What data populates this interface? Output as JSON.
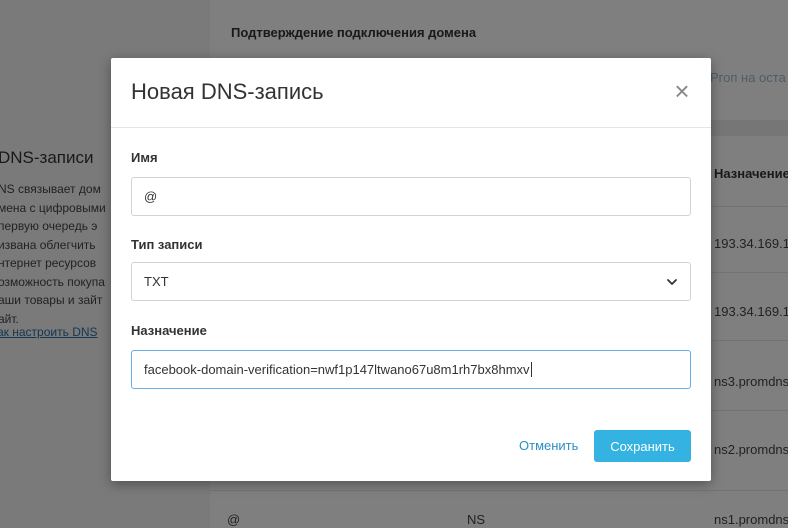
{
  "background": {
    "section_heading": "Подтверждение подключения домена",
    "faint_link": "Ргоп на оста",
    "table": {
      "column_header": "Назначение",
      "rows": [
        {
          "value": "193.34.169.1"
        },
        {
          "value": "193.34.169.1"
        },
        {
          "value": "ns3.promdns"
        },
        {
          "value": "ns2.promdns"
        },
        {
          "name": "@",
          "type": "NS",
          "value": "ns1.promdns"
        }
      ]
    },
    "sidebar": {
      "title": "DNS-записи",
      "text_lines": [
        "NS связывает дом",
        "мена с цифровыми",
        "первую очередь э",
        "извана облегчить",
        "нтернет ресурсов",
        "озможность покупа",
        "аши товары и зайт",
        "айт."
      ],
      "help_link": "ак настроить DNS"
    }
  },
  "modal": {
    "title": "Новая DNS-запись",
    "close_label": "×",
    "fields": {
      "name": {
        "label": "Имя",
        "value": "@"
      },
      "type": {
        "label": "Тип записи",
        "value": "TXT"
      },
      "target": {
        "label": "Назначение",
        "value": "facebook-domain-verification=nwf1p147ltwano67u8m1rh7bx8hmxv"
      }
    },
    "buttons": {
      "cancel": "Отменить",
      "save": "Сохранить"
    }
  },
  "colors": {
    "accent": "#34b3e2",
    "link": "#2b8fc4",
    "focus_border": "#66afe9"
  }
}
